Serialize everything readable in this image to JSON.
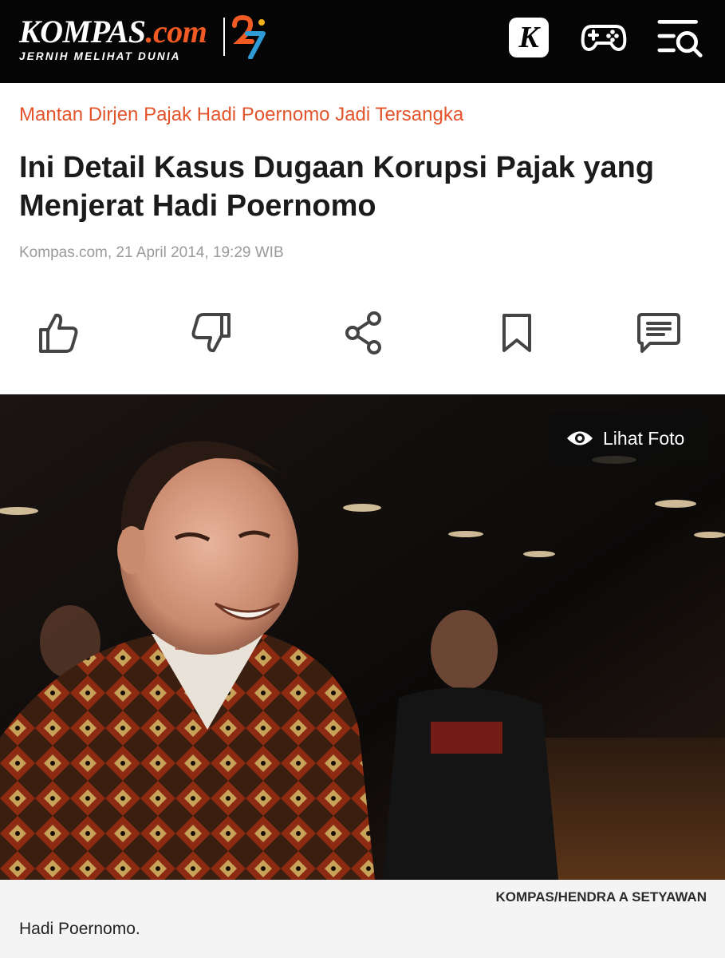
{
  "header": {
    "brand_name": "KOMPAS",
    "brand_tld": ".com",
    "tagline": "JERNIH MELIHAT DUNIA",
    "k_label": "K",
    "icons": [
      "kompas-k-icon",
      "gamepad-icon",
      "menu-search-icon"
    ]
  },
  "article": {
    "kicker": "Mantan Dirjen Pajak Hadi Poernomo Jadi Tersangka",
    "title": "Ini Detail Kasus Dugaan Korupsi Pajak yang Menjerat Hadi Poernomo",
    "byline": "Kompas.com, 21 April 2014, 19:29 WIB"
  },
  "actions": [
    "like-icon",
    "dislike-icon",
    "share-icon",
    "bookmark-icon",
    "comment-icon"
  ],
  "photo": {
    "view_label": "Lihat Foto",
    "credit": "KOMPAS/HENDRA A SETYAWAN",
    "caption": "Hadi Poernomo."
  },
  "colors": {
    "kicker": "#e3542b",
    "header_bg": "#050505",
    "brand_accent": "#f15a22"
  }
}
